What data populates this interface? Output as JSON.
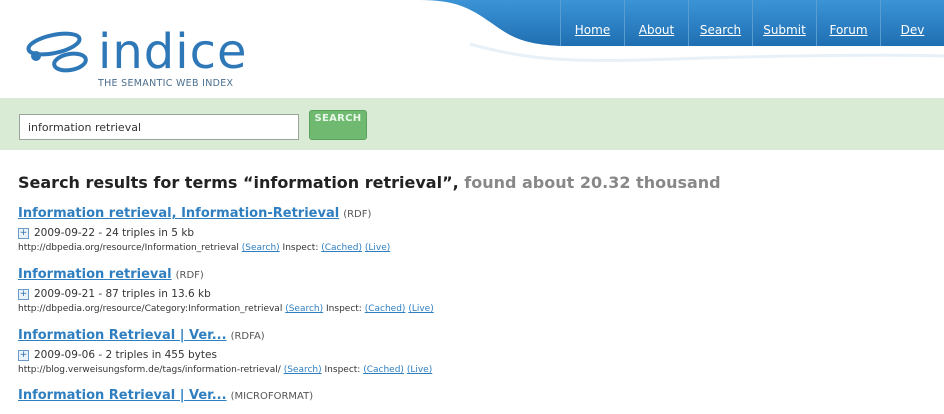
{
  "brand": {
    "logo_text": "indice",
    "tagline": "THE SEMANTIC WEB INDEX"
  },
  "nav": {
    "items": [
      "Home",
      "About",
      "Search",
      "Submit",
      "Forum",
      "Dev"
    ]
  },
  "search": {
    "query": "information retrieval",
    "button_label": "SEARCH"
  },
  "results": {
    "heading_prefix": "Search results for terms “information retrieval”,",
    "heading_found": "found about 20.32 thousand",
    "inspect_label": "Inspect:",
    "search_link": "(Search)",
    "cached_link": "(Cached)",
    "live_link": "(Live)",
    "plus": "+",
    "items": [
      {
        "title": "Information retrieval, Information-Retrieval",
        "type": "(RDF)",
        "meta": "2009-09-22 - 24 triples in 5 kb",
        "url": "http://dbpedia.org/resource/Information_retrieval"
      },
      {
        "title": "Information retrieval",
        "type": "(RDF)",
        "meta": "2009-09-21 - 87 triples in 13.6 kb",
        "url": "http://dbpedia.org/resource/Category:Information_retrieval"
      },
      {
        "title": "Information Retrieval | Ver...",
        "type": "(RDFA)",
        "meta": "2009-09-06 - 2 triples in 455 bytes",
        "url": "http://blog.verweisungsform.de/tags/information-retrieval/"
      },
      {
        "title": "Information Retrieval | Ver...",
        "type": "(MICROFORMAT)"
      }
    ]
  },
  "colors": {
    "nav_blue": "#2e86c9",
    "search_band": "#d9ead5",
    "button_green": "#6fba70",
    "link_blue": "#2f7fc0"
  }
}
